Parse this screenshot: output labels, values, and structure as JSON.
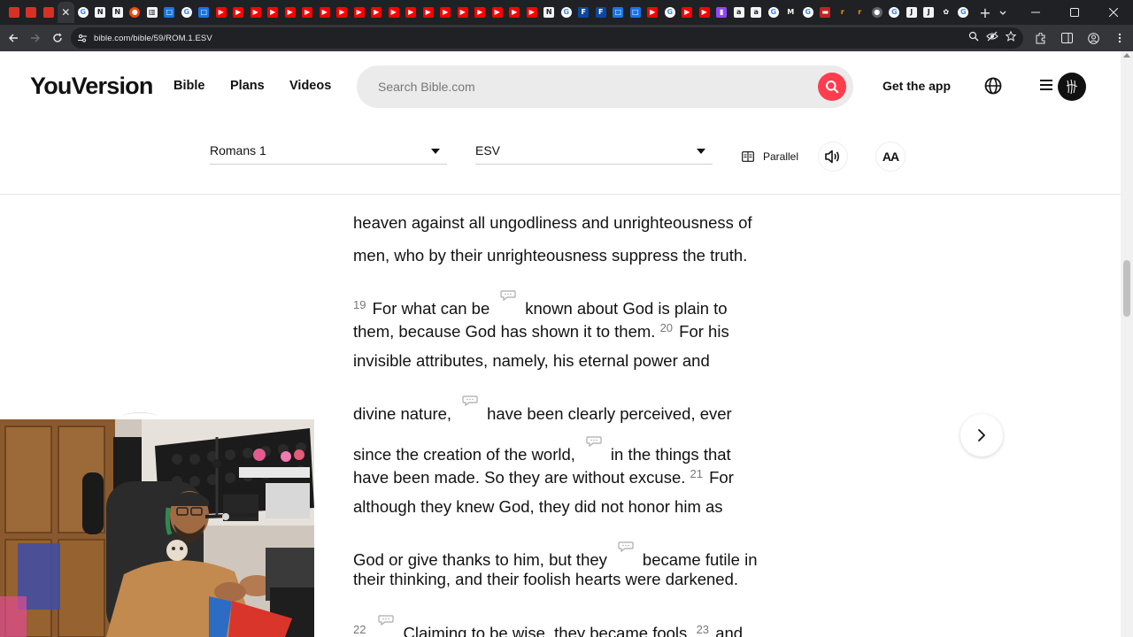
{
  "browser": {
    "tabs": [
      {
        "icon": "gmail-icon",
        "color": "#d93025",
        "glyph": ""
      },
      {
        "icon": "gmail-icon",
        "color": "#d93025",
        "glyph": ""
      },
      {
        "icon": "gmail-icon",
        "color": "#d93025",
        "glyph": ""
      },
      {
        "icon": "close-icon",
        "color": "#35363a",
        "glyph": "✕",
        "active": true
      },
      {
        "icon": "google-icon",
        "color": "#ffffff",
        "glyph": "G"
      },
      {
        "icon": "news-icon",
        "color": "#f1f3f4",
        "glyph": "N"
      },
      {
        "icon": "news-icon",
        "color": "#f1f3f4",
        "glyph": "N"
      },
      {
        "icon": "reddit-icon",
        "color": "#ff4500",
        "glyph": "●"
      },
      {
        "icon": "trash-icon",
        "color": "#f1f3f4",
        "glyph": "▥"
      },
      {
        "icon": "generic-blue-icon",
        "color": "#1a73e8",
        "glyph": "□"
      },
      {
        "icon": "google-icon",
        "color": "#ffffff",
        "glyph": "G"
      },
      {
        "icon": "generic-blue-icon",
        "color": "#1a73e8",
        "glyph": "□"
      },
      {
        "icon": "youtube-icon",
        "color": "#ff0000",
        "glyph": "▶"
      },
      {
        "icon": "youtube-icon",
        "color": "#ff0000",
        "glyph": "▶"
      },
      {
        "icon": "youtube-icon",
        "color": "#ff0000",
        "glyph": "▶"
      },
      {
        "icon": "youtube-icon",
        "color": "#ff0000",
        "glyph": "▶"
      },
      {
        "icon": "youtube-icon",
        "color": "#ff0000",
        "glyph": "▶"
      },
      {
        "icon": "youtube-icon",
        "color": "#ff0000",
        "glyph": "▶"
      },
      {
        "icon": "youtube-icon",
        "color": "#ff0000",
        "glyph": "▶"
      },
      {
        "icon": "youtube-icon",
        "color": "#ff0000",
        "glyph": "▶"
      },
      {
        "icon": "youtube-icon",
        "color": "#ff0000",
        "glyph": "▶"
      },
      {
        "icon": "youtube-icon",
        "color": "#ff0000",
        "glyph": "▶"
      },
      {
        "icon": "youtube-icon",
        "color": "#ff0000",
        "glyph": "▶"
      },
      {
        "icon": "youtube-icon",
        "color": "#ff0000",
        "glyph": "▶"
      },
      {
        "icon": "youtube-icon",
        "color": "#ff0000",
        "glyph": "▶"
      },
      {
        "icon": "youtube-icon",
        "color": "#ff0000",
        "glyph": "▶"
      },
      {
        "icon": "youtube-icon",
        "color": "#ff0000",
        "glyph": "▶"
      },
      {
        "icon": "youtube-icon",
        "color": "#ff0000",
        "glyph": "▶"
      },
      {
        "icon": "youtube-icon",
        "color": "#ff0000",
        "glyph": "▶"
      },
      {
        "icon": "youtube-icon",
        "color": "#ff0000",
        "glyph": "▶"
      },
      {
        "icon": "youtube-icon",
        "color": "#ff0000",
        "glyph": "▶"
      },
      {
        "icon": "news-icon",
        "color": "#f1f3f4",
        "glyph": "N"
      },
      {
        "icon": "google-icon",
        "color": "#ffffff",
        "glyph": "G"
      },
      {
        "icon": "fbs-icon",
        "color": "#0d47a1",
        "glyph": "F"
      },
      {
        "icon": "fbs-icon",
        "color": "#0d47a1",
        "glyph": "F"
      },
      {
        "icon": "generic-blue-icon",
        "color": "#1a73e8",
        "glyph": "□"
      },
      {
        "icon": "generic-blue-icon",
        "color": "#1a73e8",
        "glyph": "□"
      },
      {
        "icon": "youtube-icon",
        "color": "#ff0000",
        "glyph": "▶"
      },
      {
        "icon": "google-icon",
        "color": "#ffffff",
        "glyph": "G"
      },
      {
        "icon": "youtube-icon",
        "color": "#ff0000",
        "glyph": "▶"
      },
      {
        "icon": "youtube-icon",
        "color": "#ff0000",
        "glyph": "▶"
      },
      {
        "icon": "twitch-icon",
        "color": "#9146ff",
        "glyph": "▮"
      },
      {
        "icon": "amazon-icon",
        "color": "#f1f3f4",
        "glyph": "a"
      },
      {
        "icon": "amazon-icon",
        "color": "#f1f3f4",
        "glyph": "a"
      },
      {
        "icon": "google-icon",
        "color": "#ffffff",
        "glyph": "G"
      },
      {
        "icon": "medium-icon",
        "color": "#202124",
        "glyph": "M"
      },
      {
        "icon": "google-icon",
        "color": "#ffffff",
        "glyph": "G"
      },
      {
        "icon": "red-square-icon",
        "color": "#c5221f",
        "glyph": "▬"
      },
      {
        "icon": "orange-r-icon",
        "color": "#202124",
        "glyph": "r"
      },
      {
        "icon": "orange-r-icon",
        "color": "#202124",
        "glyph": "r"
      },
      {
        "icon": "robot-icon",
        "color": "#5f6368",
        "glyph": "●"
      },
      {
        "icon": "google-icon",
        "color": "#ffffff",
        "glyph": "G"
      },
      {
        "icon": "jira-icon",
        "color": "#f1f3f4",
        "glyph": "J"
      },
      {
        "icon": "jira-icon",
        "color": "#f1f3f4",
        "glyph": "J"
      },
      {
        "icon": "chatgpt-icon",
        "color": "#202124",
        "glyph": "✿"
      },
      {
        "icon": "google-icon",
        "color": "#ffffff",
        "glyph": "G"
      }
    ],
    "new_tab_glyph": "+",
    "url": "bible.com/bible/59/ROM.1.ESV"
  },
  "site": {
    "logo": "YouVersion",
    "nav": [
      "Bible",
      "Plans",
      "Videos"
    ],
    "search_placeholder": "Search Bible.com",
    "get_app": "Get the app"
  },
  "reader": {
    "book_chapter": "Romans 1",
    "version": "ESV",
    "parallel_label": "Parallel",
    "font_button": "AA"
  },
  "chapter_lines": [
    {
      "tall": false,
      "segments": [
        {
          "t": "text",
          "v": "heaven against all ungodliness and unrighteousness of"
        }
      ]
    },
    {
      "tall": false,
      "segments": [
        {
          "t": "text",
          "v": "men, who by their unrighteousness suppress the truth."
        }
      ]
    },
    {
      "tall": true,
      "segments": [
        {
          "t": "vnum",
          "v": "19"
        },
        {
          "t": "text",
          "v": "For what can be"
        },
        {
          "t": "note"
        },
        {
          "t": "text",
          "v": "known about God is plain to"
        }
      ]
    },
    {
      "tall": false,
      "segments": [
        {
          "t": "text",
          "v": "them, because God has shown it to them. "
        },
        {
          "t": "vnum",
          "v": "20"
        },
        {
          "t": "text",
          "v": "For his"
        }
      ]
    },
    {
      "tall": false,
      "segments": [
        {
          "t": "text",
          "v": "invisible attributes, namely, his eternal power and"
        }
      ]
    },
    {
      "tall": true,
      "segments": [
        {
          "t": "text",
          "v": "divine nature,"
        },
        {
          "t": "note"
        },
        {
          "t": "text",
          "v": "have been clearly perceived, ever"
        }
      ]
    },
    {
      "tall": true,
      "segments": [
        {
          "t": "text",
          "v": "since the creation of the world,"
        },
        {
          "t": "note"
        },
        {
          "t": "text",
          "v": "in the things that"
        }
      ]
    },
    {
      "tall": false,
      "segments": [
        {
          "t": "text",
          "v": "have been made. So they are without excuse. "
        },
        {
          "t": "vnum",
          "v": "21"
        },
        {
          "t": "text",
          "v": "For"
        }
      ]
    },
    {
      "tall": false,
      "segments": [
        {
          "t": "text",
          "v": "although they knew God, they did not honor him as"
        }
      ]
    },
    {
      "tall": true,
      "segments": [
        {
          "t": "text",
          "v": "God or give thanks to him, but they"
        },
        {
          "t": "note"
        },
        {
          "t": "text",
          "v": "became futile in"
        }
      ]
    },
    {
      "tall": false,
      "segments": [
        {
          "t": "text",
          "v": "their thinking, and their foolish hearts were darkened."
        }
      ]
    },
    {
      "tall": true,
      "segments": [
        {
          "t": "vnum",
          "v": "22"
        },
        {
          "t": "note"
        },
        {
          "t": "text",
          "v": "Claiming to be wise, they became fools, "
        },
        {
          "t": "vnum",
          "v": "23"
        },
        {
          "t": "text",
          "v": "and"
        }
      ]
    }
  ],
  "colors": {
    "search_button": "#ff3d4d",
    "text": "#121212",
    "verse_number": "#777777"
  }
}
